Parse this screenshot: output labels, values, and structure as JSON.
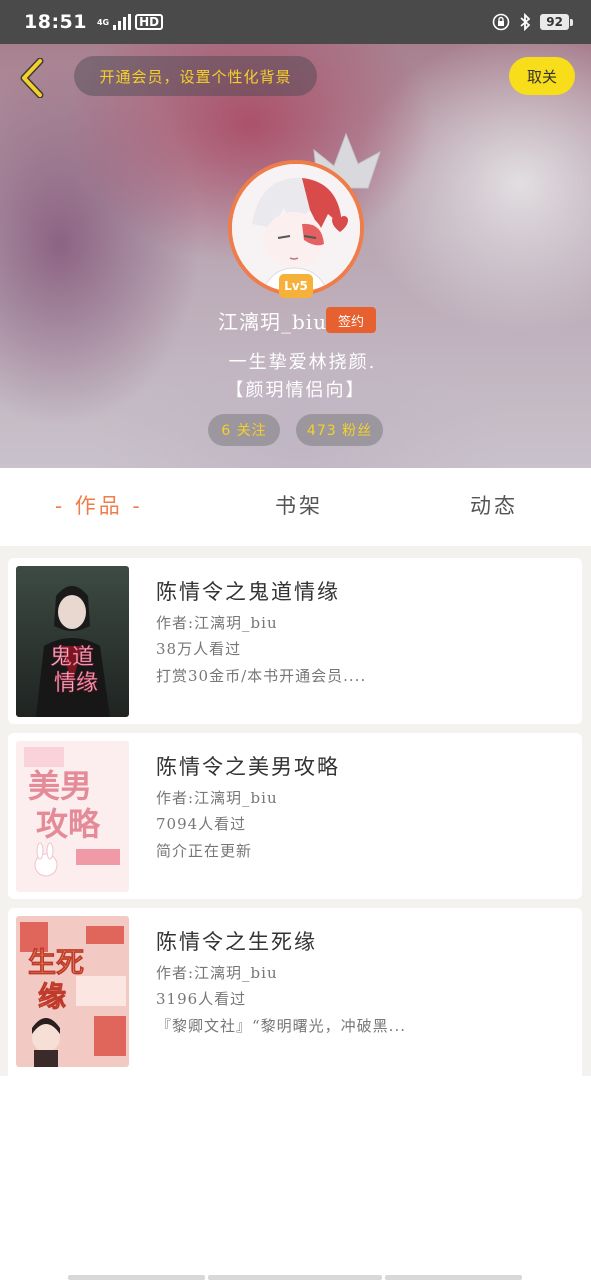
{
  "status_bar": {
    "time": "18:51",
    "network": "4G",
    "hd": "HD",
    "battery": "92"
  },
  "header": {
    "vip_prompt": "开通会员，设置个性化背景",
    "unfollow_label": "取关",
    "level": "Lv5",
    "username": "江漓玥_biu",
    "signed_badge": "签约",
    "bio_line1": "一生挚爱林挠颜.",
    "bio_line2": "【颜玥情侣向】",
    "follow_stat": "6 关注",
    "fans_stat": "473 粉丝"
  },
  "tabs": {
    "works": "- 作品 -",
    "shelf": "书架",
    "feed": "动态",
    "active": "works"
  },
  "books": [
    {
      "title": "陈情令之鬼道情缘",
      "author": "作者:江漓玥_biu",
      "views": "38万人看过",
      "desc": "打赏30金币/本书开通会员....",
      "cover_text": "鬼道情缘"
    },
    {
      "title": "陈情令之美男攻略",
      "author": "作者:江漓玥_biu",
      "views": "7094人看过",
      "desc": "简介正在更新",
      "cover_text": "美男攻略"
    },
    {
      "title": "陈情令之生死缘",
      "author": "作者:江漓玥_biu",
      "views": "3196人看过",
      "desc": "『黎卿文社』“黎明曙光，冲破黑...",
      "cover_text": "生死缘"
    }
  ],
  "colors": {
    "accent": "#ef7d4a",
    "vip_text": "#f5d02a",
    "unfollow_bg": "#f7dd1a",
    "status_bar": "#4a4a4a"
  }
}
